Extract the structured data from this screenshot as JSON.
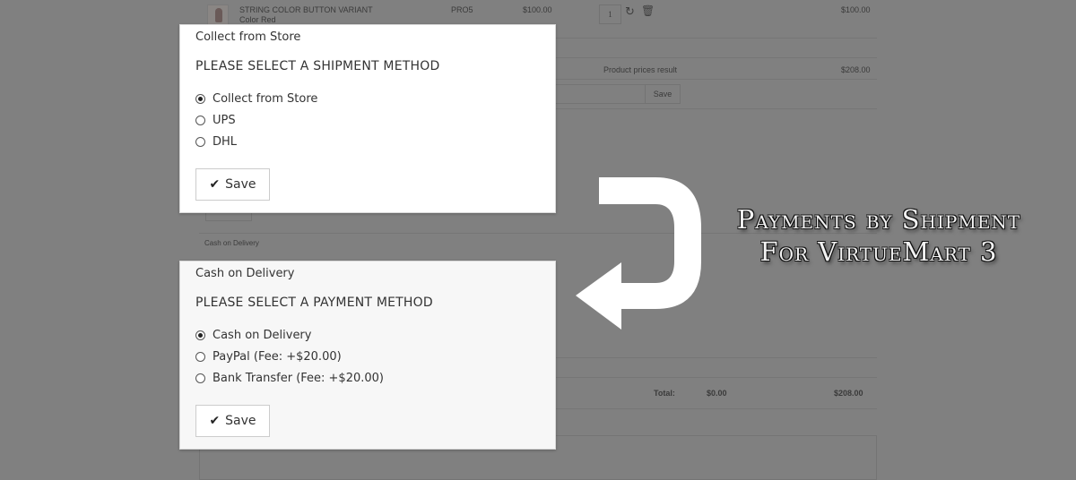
{
  "background_cart": {
    "product": {
      "name": "STRING COLOR BUTTON VARIANT",
      "variant": "Color Red",
      "sku": "PRO5",
      "price": "$100.00",
      "quantity": "1",
      "subtotal": "$100.00"
    },
    "product_prices_label": "Product prices result",
    "product_prices_value": "$208.00",
    "coupon_save_label": "Save",
    "shipment_save_label": "Save",
    "payment_row_label": "Cash on Delivery",
    "total_label": "Total:",
    "total_tax": "$0.00",
    "total_value": "$208.00"
  },
  "shipment_modal": {
    "header": "Collect from Store",
    "title": "PLEASE SELECT A SHIPMENT METHOD",
    "options": [
      {
        "label": "Collect from Store",
        "selected": true
      },
      {
        "label": "UPS",
        "selected": false
      },
      {
        "label": "DHL",
        "selected": false
      }
    ],
    "save_label": "Save"
  },
  "payment_modal": {
    "header": "Cash on Delivery",
    "title": "PLEASE SELECT A PAYMENT METHOD",
    "options": [
      {
        "label": "Cash on Delivery",
        "selected": true
      },
      {
        "label": "PayPal (Fee: +$20.00)",
        "selected": false
      },
      {
        "label": "Bank Transfer (Fee: +$20.00)",
        "selected": false
      }
    ],
    "save_label": "Save"
  },
  "caption": {
    "line1": "Payments by Shipment",
    "line2": "For VirtueMart 3"
  },
  "colors": {
    "overlay": "#808080",
    "modal_bg": "#ffffff",
    "caption_text": "#f2f2f2"
  }
}
